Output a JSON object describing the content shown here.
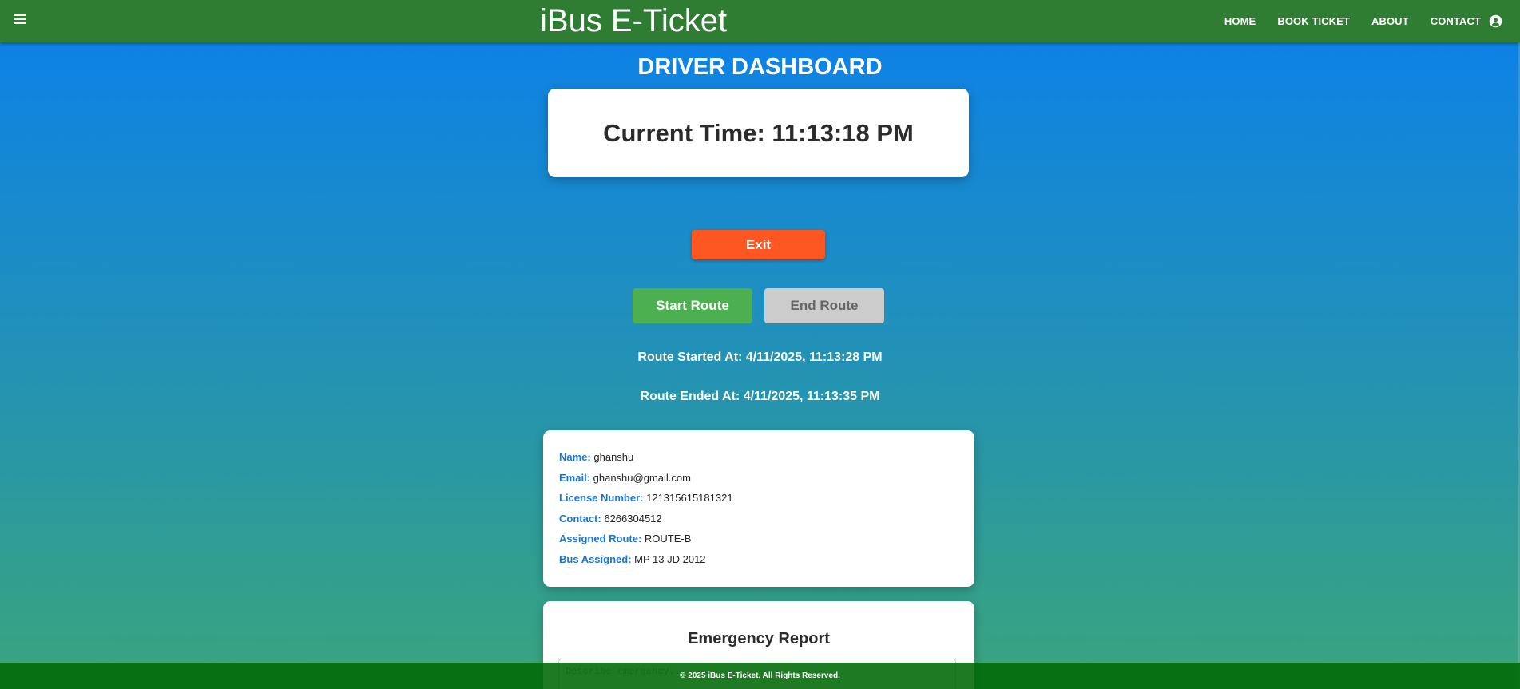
{
  "navbar": {
    "title": "iBus E-Ticket",
    "links": [
      "HOME",
      "BOOK TICKET",
      "ABOUT",
      "CONTACT"
    ],
    "menu_icon": "hamburger-icon",
    "account_icon": "account-circle-icon",
    "color": "#2e7d32"
  },
  "dashboard": {
    "title": "DRIVER DASHBOARD",
    "current_time": "Current Time: 11:13:18 PM",
    "exit_label": "Exit",
    "start_label": "Start Route",
    "end_label": "End Route",
    "route_started": "Route Started At: 4/11/2025, 11:13:28 PM",
    "route_ended": "Route Ended At: 4/11/2025, 11:13:35 PM"
  },
  "driver": {
    "name_label": "Name:",
    "name": "ghanshu",
    "email_label": "Email:",
    "email": "ghanshu@gmail.com",
    "license_label": "License Number:",
    "license": "121315615181321",
    "contact_label": "Contact:",
    "contact": "6266304512",
    "route_label": "Assigned Route:",
    "route": "ROUTE-B",
    "bus_label": "Bus Assigned:",
    "bus": "MP 13 JD 2012"
  },
  "emergency": {
    "title": "Emergency Report",
    "placeholder": "Describe emergency..."
  },
  "footer": {
    "text": "© 2025 iBus E-Ticket. All Rights Reserved."
  },
  "colors": {
    "exit": "#ff5722",
    "start": "#4caf50",
    "end_disabled": "#cccccc",
    "label": "#1976d2"
  }
}
